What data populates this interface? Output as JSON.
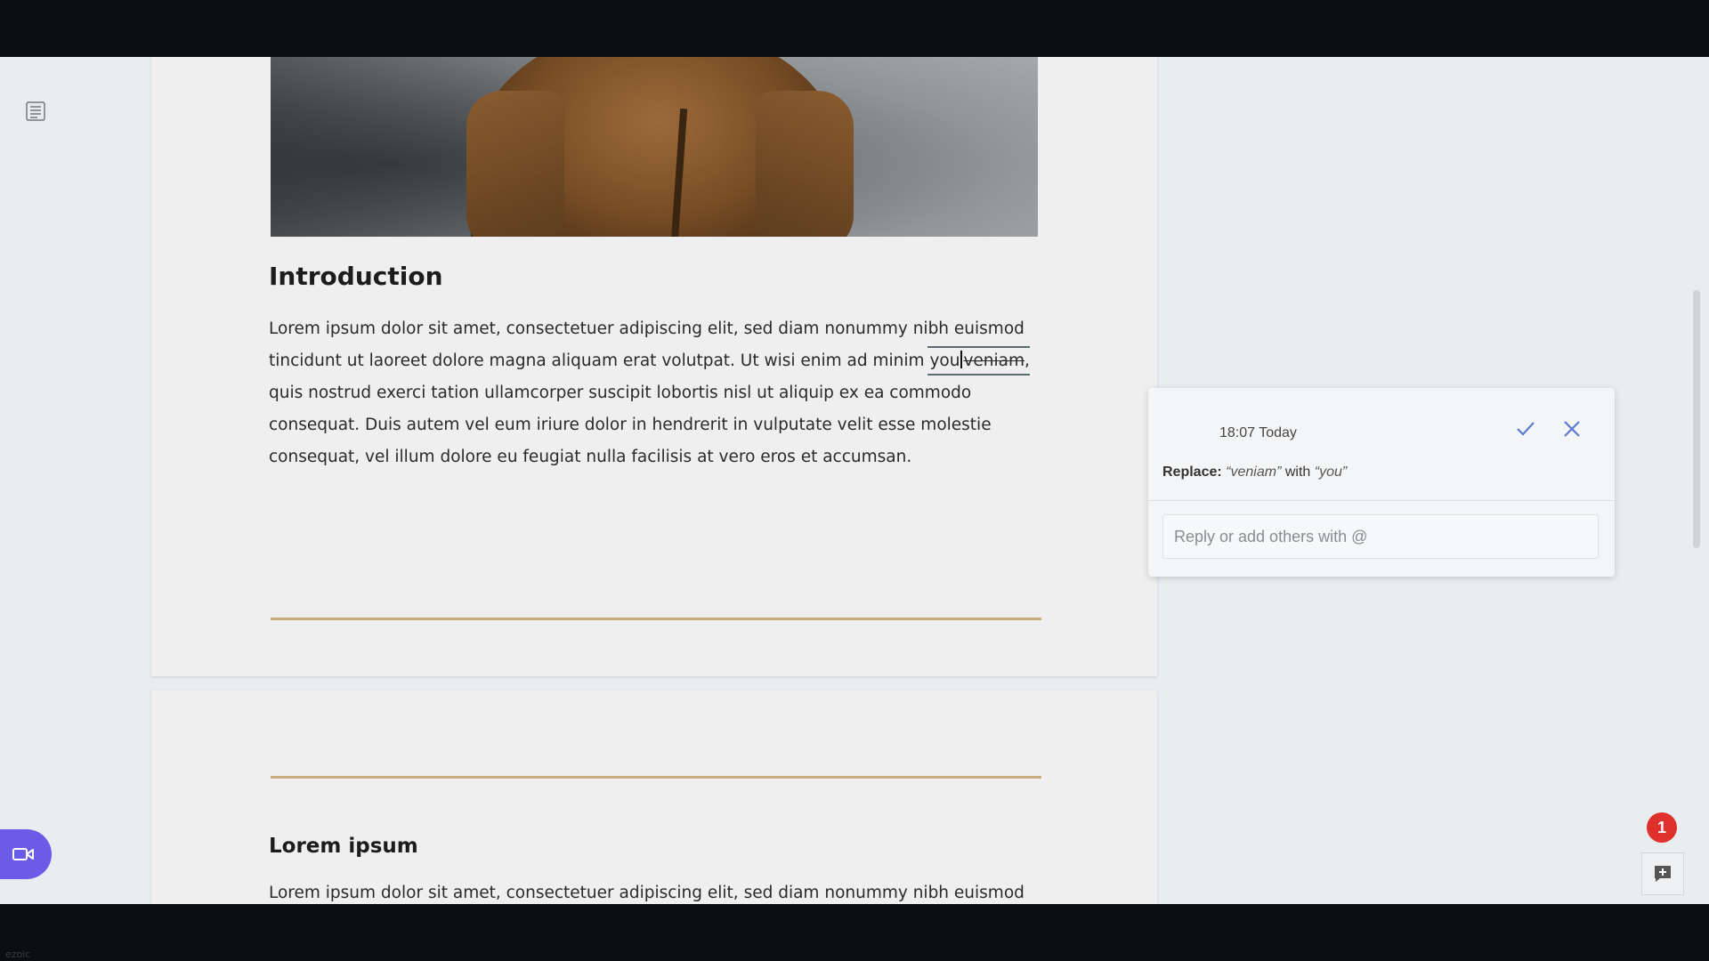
{
  "watermark": "ezoic",
  "sidebar": {
    "outline_icon": "list-icon"
  },
  "document": {
    "page1": {
      "heading": "Introduction",
      "para": {
        "part1": "Lorem ipsum dolor sit amet, consectetuer adipiscing elit, sed diam nonummy nibh euismod tincidunt ut laoreet dolore magna aliquam erat volutpat. Ut wisi enim ad minim ",
        "suggestion_insert": "you",
        "suggestion_delete": "veniam",
        "part2": ", quis nostrud exerci tation ullamcorper suscipit lobortis nisl ut aliquip ex ea commodo consequat. Duis autem vel eum iriure dolor in hendrerit in vulputate velit esse molestie consequat, vel illum dolore eu feugiat nulla facilisis at vero eros et accumsan."
      }
    },
    "page2": {
      "heading": "Lorem ipsum",
      "para": "Lorem ipsum dolor sit amet, consectetuer adipiscing elit, sed diam nonummy nibh euismod"
    }
  },
  "comment": {
    "time": "18:07 Today",
    "summary_label": "Replace:",
    "old_word": "“veniam”",
    "with": "with",
    "new_word": "“you”",
    "reply_placeholder": "Reply or add others with @",
    "accept_icon": "check-icon",
    "reject_icon": "close-icon"
  },
  "badge_count": "1",
  "colors": {
    "accent": "#6b5ce7",
    "badge": "#e0302c",
    "divider": "#c9ab80"
  }
}
